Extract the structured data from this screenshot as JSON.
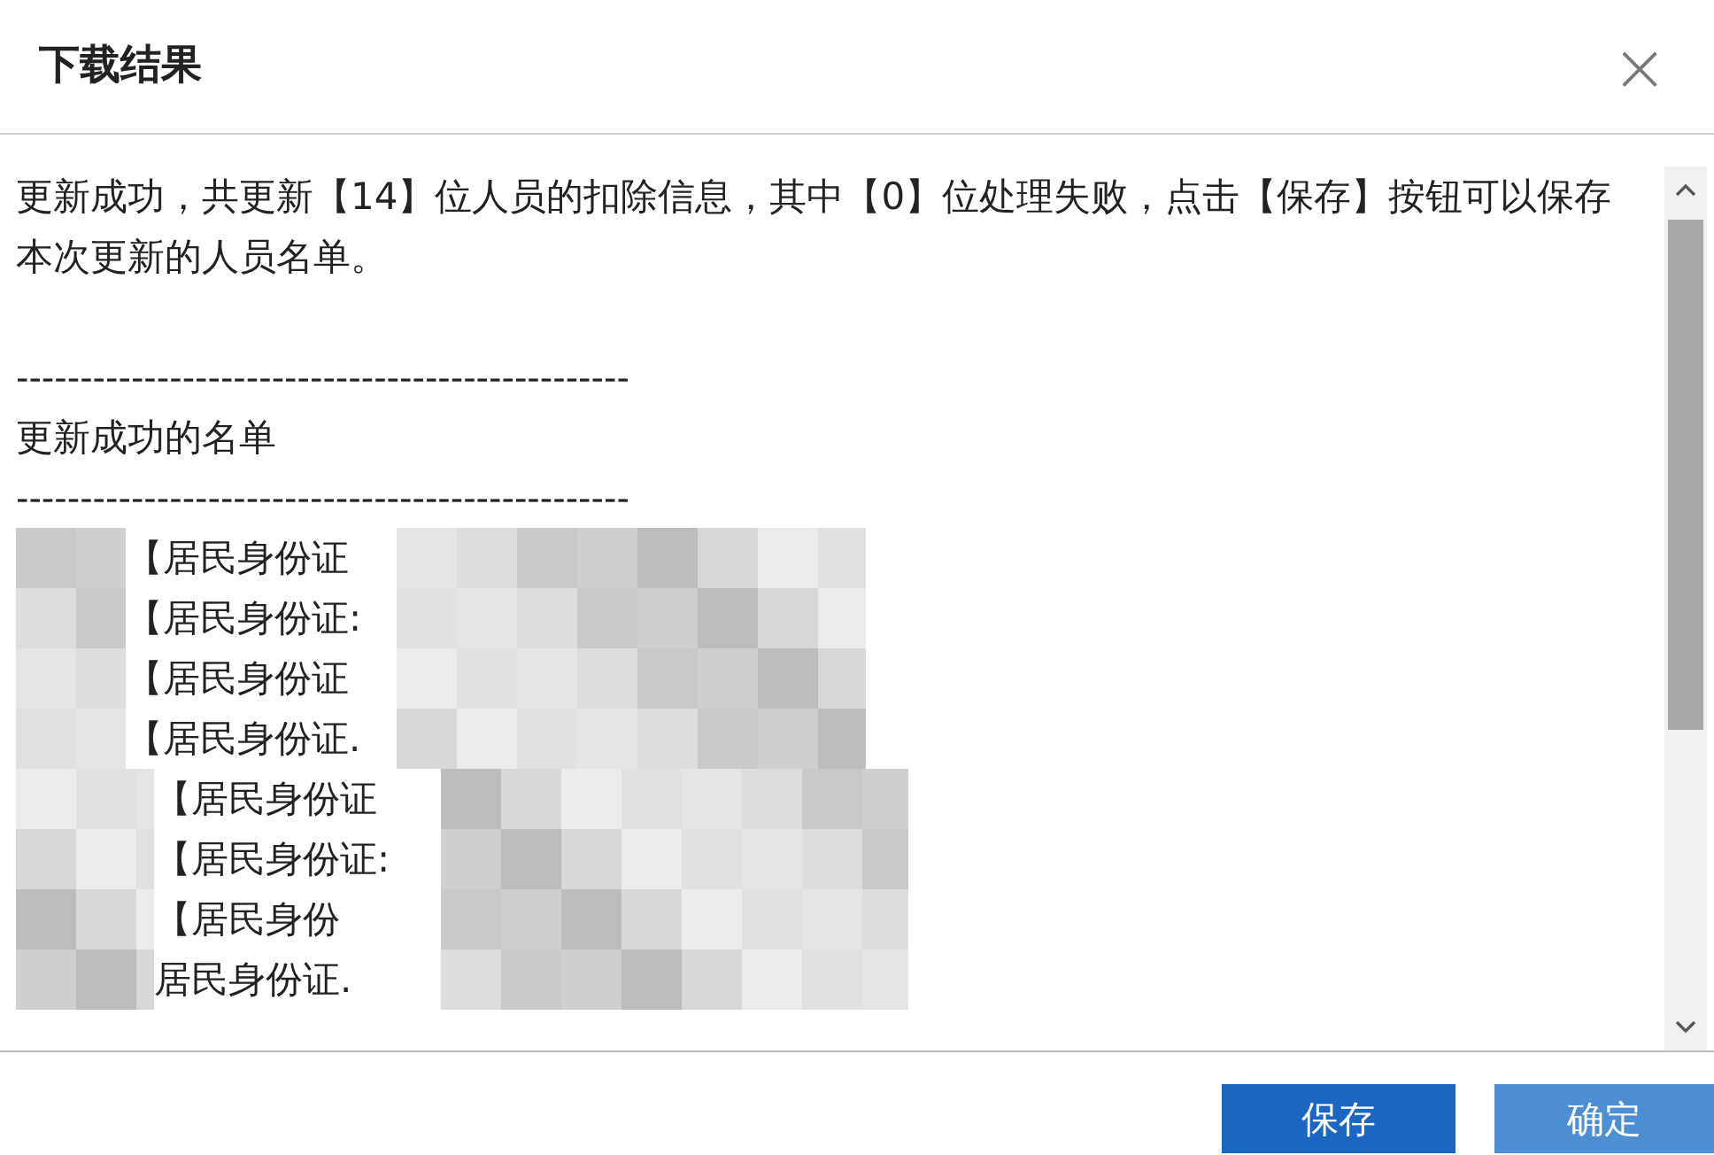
{
  "dialog": {
    "title": "下载结果",
    "close": "×"
  },
  "content": {
    "message": "更新成功，共更新【14】位人员的扣除信息，其中【0】位处理失败，点击【保存】按钮可以保存本次更新的人员名单。",
    "separator_1": "------------------------------------------------",
    "heading": "更新成功的名单",
    "separator_2": "------------------------------------------------",
    "rows": [
      {
        "text": "【居民身份证",
        "indented": false
      },
      {
        "text": "【居民身份证:",
        "indented": false
      },
      {
        "text": "【居民身份证",
        "indented": false
      },
      {
        "text": "【居民身份证.",
        "indented": false
      },
      {
        "text": "【居民身份证",
        "indented": true
      },
      {
        "text": "【居民身份证:",
        "indented": true
      },
      {
        "text": "【居民身份",
        "indented": true
      },
      {
        "text": "居民身份证.",
        "indented": true
      }
    ]
  },
  "buttons": [
    {
      "label": "保存",
      "kind": "primary"
    },
    {
      "label": "确定",
      "kind": "secondary"
    }
  ]
}
